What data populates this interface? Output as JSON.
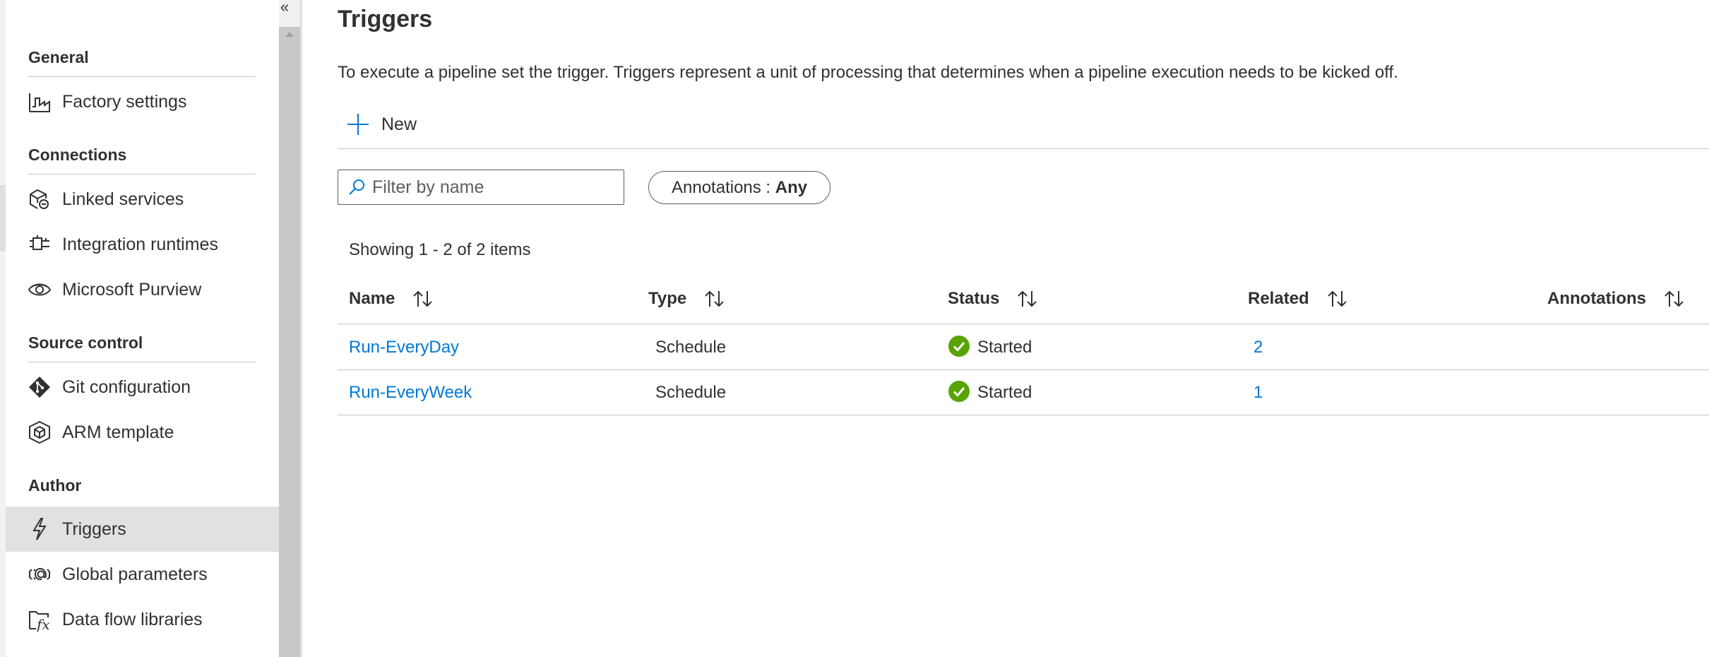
{
  "sidebar": {
    "collapse_glyph": "«",
    "sections": [
      {
        "header": "General",
        "items": [
          {
            "label": "Factory settings",
            "icon": "factory-settings-icon"
          }
        ]
      },
      {
        "header": "Connections",
        "items": [
          {
            "label": "Linked services",
            "icon": "linked-services-icon"
          },
          {
            "label": "Integration runtimes",
            "icon": "integration-runtimes-icon"
          },
          {
            "label": "Microsoft Purview",
            "icon": "purview-eye-icon"
          }
        ]
      },
      {
        "header": "Source control",
        "items": [
          {
            "label": "Git configuration",
            "icon": "git-icon"
          },
          {
            "label": "ARM template",
            "icon": "arm-template-icon"
          }
        ]
      },
      {
        "header": "Author",
        "items": [
          {
            "label": "Triggers",
            "icon": "lightning-icon",
            "selected": true
          },
          {
            "label": "Global parameters",
            "icon": "global-parameters-icon"
          },
          {
            "label": "Data flow libraries",
            "icon": "data-flow-libraries-icon"
          }
        ]
      }
    ]
  },
  "main": {
    "title": "Triggers",
    "description": "To execute a pipeline set the trigger. Triggers represent a unit of processing that determines when a pipeline execution needs to be kicked off.",
    "new_label": "New",
    "filter_placeholder": "Filter by name",
    "annotations_filter": {
      "label": "Annotations : ",
      "value": "Any"
    },
    "item_count": "Showing 1 - 2 of 2 items",
    "columns": [
      "Name",
      "Type",
      "Status",
      "Related",
      "Annotations"
    ],
    "rows": [
      {
        "name": "Run-EveryDay",
        "type": "Schedule",
        "status": "Started",
        "related": "2",
        "annotations": ""
      },
      {
        "name": "Run-EveryWeek",
        "type": "Schedule",
        "status": "Started",
        "related": "1",
        "annotations": ""
      }
    ]
  },
  "colors": {
    "accent": "#0078d4",
    "status_ok": "#57a300",
    "selected_bg": "#e1e1e1"
  }
}
